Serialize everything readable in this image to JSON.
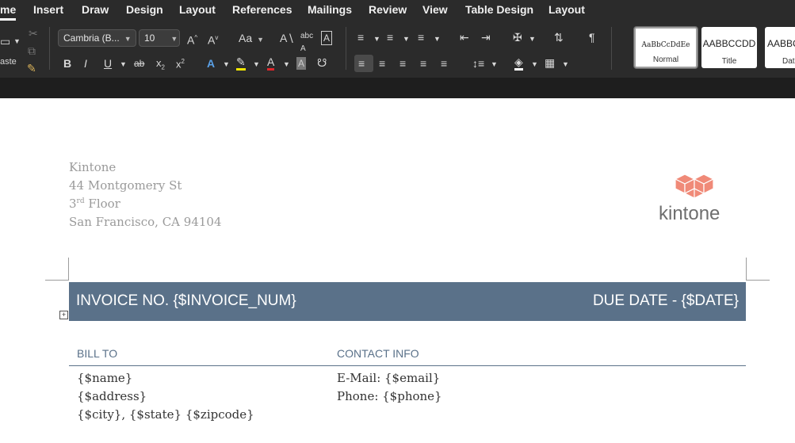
{
  "menu": {
    "items": [
      "me",
      "Insert",
      "Draw",
      "Design",
      "Layout",
      "References",
      "Mailings",
      "Review",
      "View",
      "Table Design",
      "Layout"
    ]
  },
  "ribbon": {
    "paste_label": "aste",
    "font_name": "Cambria (B...",
    "font_size": "10",
    "change_case_label": "Aa",
    "styles": [
      {
        "sample": "AaBbCcDdEe",
        "name": "Normal"
      },
      {
        "sample": "AABBCCDD",
        "name": "Title"
      },
      {
        "sample": "AABBC",
        "name": "Dat"
      }
    ]
  },
  "document": {
    "sender": {
      "company": "Kintone",
      "street": "44 Montgomery St",
      "floor_number": "3",
      "floor_suffix": "rd",
      "floor_word": "Floor",
      "city_line": "San Francisco, CA 94104"
    },
    "logo_text": "kintone",
    "banner": {
      "invoice": "INVOICE NO. {$INVOICE_NUM}",
      "due": "DUE DATE - {$DATE}"
    },
    "bill_to": {
      "heading": "BILL TO",
      "name": "{$name}",
      "address": "{$address}",
      "city_line": "{$city}, {$state} {$zipcode}"
    },
    "contact": {
      "heading": "CONTACT INFO",
      "email": "E-Mail: {$email}",
      "phone": "Phone: {$phone}"
    }
  },
  "colors": {
    "banner": "#5a7189",
    "logo": "#f08a78",
    "menubar": "#2b2b2b"
  }
}
